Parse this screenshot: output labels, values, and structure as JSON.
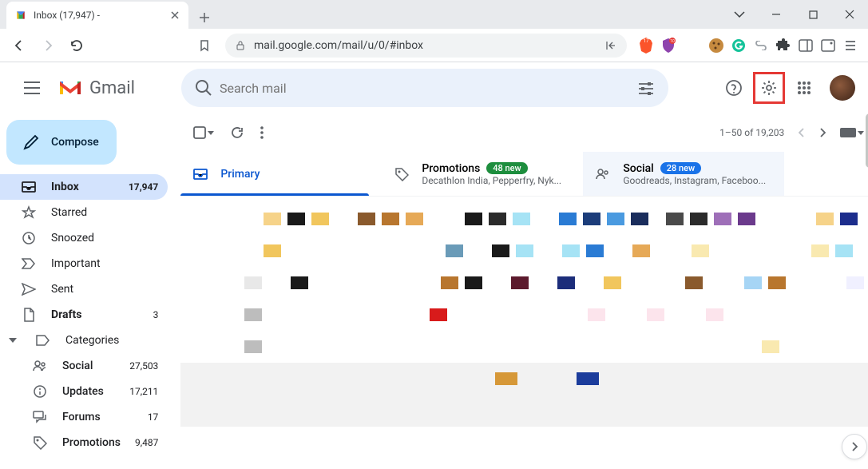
{
  "browser": {
    "tab_title": "Inbox (17,947) - ",
    "url": "mail.google.com/mail/u/0/#inbox"
  },
  "header": {
    "logo_text": "Gmail",
    "search_placeholder": "Search mail"
  },
  "compose": {
    "label": "Compose"
  },
  "sidebar": {
    "items": [
      {
        "label": "Inbox",
        "count": "17,947",
        "active": true
      },
      {
        "label": "Starred"
      },
      {
        "label": "Snoozed"
      },
      {
        "label": "Important"
      },
      {
        "label": "Sent"
      },
      {
        "label": "Drafts",
        "count": "3"
      },
      {
        "label": "Categories"
      }
    ],
    "categories": [
      {
        "label": "Social",
        "count": "27,503"
      },
      {
        "label": "Updates",
        "count": "17,211"
      },
      {
        "label": "Forums",
        "count": "17"
      },
      {
        "label": "Promotions",
        "count": "9,487"
      }
    ]
  },
  "list_toolbar": {
    "range": "1–50 of 19,203"
  },
  "tabs": [
    {
      "label": "Primary",
      "active": true
    },
    {
      "label": "Promotions",
      "badge": "48 new",
      "sub": "Decathlon India, Pepperfry, Nyk..."
    },
    {
      "label": "Social",
      "badge": "28 new",
      "badge_color": "blue",
      "sub": "Goodreads, Instagram, Faceboo..."
    }
  ]
}
